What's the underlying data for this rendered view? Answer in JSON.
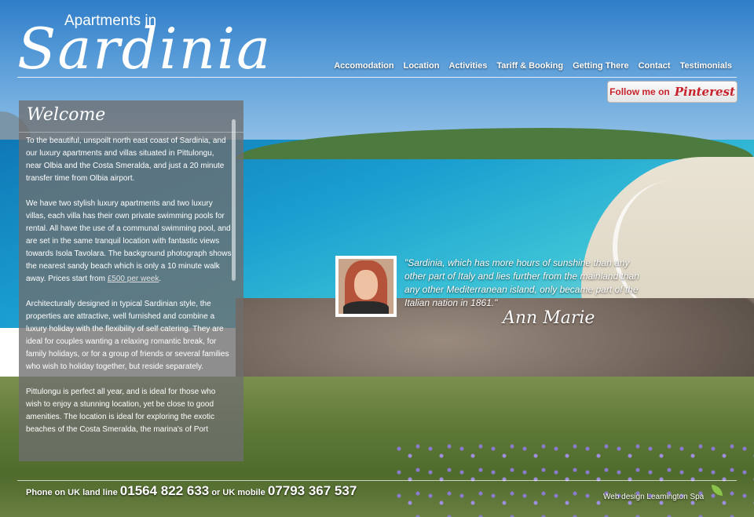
{
  "logo": {
    "small": "Apartments in",
    "big": "Sardinia"
  },
  "nav": {
    "items": [
      "Accomodation",
      "Location",
      "Activities",
      "Tariff & Booking",
      "Getting There",
      "Contact",
      "Testimonials"
    ]
  },
  "pinterest": {
    "label": "Follow me on",
    "brand": "Pinterest"
  },
  "welcome": {
    "title": "Welcome",
    "p1": "To the beautiful, unspoilt north east coast of Sardinia, and our luxury apartments and villas situated in Pittulongu, near Olbia and the Costa Smeralda, and just a 20 minute transfer time from Olbia airport.",
    "p2_before": "We have two stylish luxury apartments and two luxury villas, each villa has their own private swimming pools for rental. All have the use of a communal swimming pool, and are set in the same tranquil location with fantastic views towards Isola Tavolara. The background photograph shows the nearest sandy beach which is only a 10 minute walk away. Prices start from ",
    "p2_link": "£500 per week",
    "p2_after": ".",
    "p3": "Architecturally designed in typical Sardinian style, the properties are attractive, well furnished and combine a luxury holiday with the flexibility of self catering. They are ideal for couples wanting a relaxing romantic break, for family holidays, or for a group of friends or several families who wish to holiday together, but reside separately.",
    "p4": "Pittulongu is perfect all year, and is ideal for those who wish to enjoy a stunning location, yet be close to good amenities. The location is ideal for exploring the exotic beaches of the Costa Smeralda, the marina's of Port"
  },
  "testimonial": {
    "quote": "\"Sardinia, which has more hours of sunshine than any other part of Italy and lies further from the mainland than any other Mediterranean island, only became part of the Italian nation in 1861.\"",
    "signature": "Ann Marie"
  },
  "footer": {
    "phone_label1": "Phone on UK land line",
    "phone_land": "01564 822 633",
    "phone_label2": "or UK mobile",
    "phone_mobile": "07793 367 537",
    "credit": "Web design Leamington Spa"
  },
  "colors": {
    "pinterest_red": "#c8232c",
    "panel_bg": "rgba(110,110,110,0.78)"
  }
}
